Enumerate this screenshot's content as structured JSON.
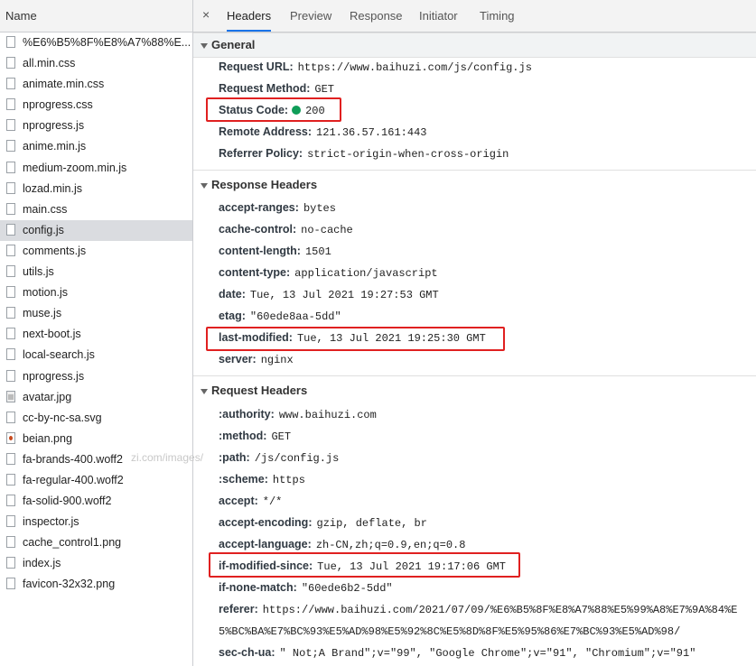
{
  "left_panel": {
    "header": "Name",
    "files": [
      {
        "name": "%E6%B5%8F%E8%A7%88%E...",
        "icon": "doc-icon"
      },
      {
        "name": "all.min.css",
        "icon": "doc-icon"
      },
      {
        "name": "animate.min.css",
        "icon": "doc-icon"
      },
      {
        "name": "nprogress.css",
        "icon": "doc-icon"
      },
      {
        "name": "nprogress.js",
        "icon": "doc-icon"
      },
      {
        "name": "anime.min.js",
        "icon": "doc-icon"
      },
      {
        "name": "medium-zoom.min.js",
        "icon": "doc-icon"
      },
      {
        "name": "lozad.min.js",
        "icon": "doc-icon"
      },
      {
        "name": "main.css",
        "icon": "doc-icon"
      },
      {
        "name": "config.js",
        "icon": "doc-icon",
        "selected": true
      },
      {
        "name": "comments.js",
        "icon": "doc-icon"
      },
      {
        "name": "utils.js",
        "icon": "doc-icon"
      },
      {
        "name": "motion.js",
        "icon": "doc-icon"
      },
      {
        "name": "muse.js",
        "icon": "doc-icon"
      },
      {
        "name": "next-boot.js",
        "icon": "doc-icon"
      },
      {
        "name": "local-search.js",
        "icon": "doc-icon"
      },
      {
        "name": "nprogress.js",
        "icon": "doc-icon"
      },
      {
        "name": "avatar.jpg",
        "icon": "image-icon"
      },
      {
        "name": "cc-by-nc-sa.svg",
        "icon": "doc-icon"
      },
      {
        "name": "beian.png",
        "icon": "beian-image-icon"
      },
      {
        "name": "fa-brands-400.woff2",
        "icon": "doc-icon"
      },
      {
        "name": "fa-regular-400.woff2",
        "icon": "doc-icon"
      },
      {
        "name": "fa-solid-900.woff2",
        "icon": "doc-icon"
      },
      {
        "name": "inspector.js",
        "icon": "doc-icon"
      },
      {
        "name": "cache_control1.png",
        "icon": "doc-icon"
      },
      {
        "name": "index.js",
        "icon": "doc-icon"
      },
      {
        "name": "favicon-32x32.png",
        "icon": "doc-icon"
      }
    ],
    "watermark": "zi.com/images/"
  },
  "tabs": {
    "close": "×",
    "items": [
      "Headers",
      "Preview",
      "Response",
      "Initiator",
      "Timing"
    ],
    "active": "Headers"
  },
  "general": {
    "title": "General",
    "rows": [
      {
        "k": "Request URL:",
        "v": "https://www.baihuzi.com/js/config.js"
      },
      {
        "k": "Request Method:",
        "v": "GET"
      },
      {
        "k": "Status Code:",
        "v": "200"
      },
      {
        "k": "Remote Address:",
        "v": "121.36.57.161:443"
      },
      {
        "k": "Referrer Policy:",
        "v": "strict-origin-when-cross-origin"
      }
    ]
  },
  "response_headers": {
    "title": "Response Headers",
    "rows": [
      {
        "k": "accept-ranges:",
        "v": "bytes"
      },
      {
        "k": "cache-control:",
        "v": "no-cache"
      },
      {
        "k": "content-length:",
        "v": "1501"
      },
      {
        "k": "content-type:",
        "v": "application/javascript"
      },
      {
        "k": "date:",
        "v": "Tue, 13 Jul 2021 19:27:53 GMT"
      },
      {
        "k": "etag:",
        "v": "\"60ede8aa-5dd\""
      },
      {
        "k": "last-modified:",
        "v": "Tue, 13 Jul 2021 19:25:30 GMT"
      },
      {
        "k": "server:",
        "v": "nginx"
      }
    ]
  },
  "request_headers": {
    "title": "Request Headers",
    "rows": [
      {
        "k": ":authority:",
        "v": "www.baihuzi.com"
      },
      {
        "k": ":method:",
        "v": "GET"
      },
      {
        "k": ":path:",
        "v": "/js/config.js"
      },
      {
        "k": ":scheme:",
        "v": "https"
      },
      {
        "k": "accept:",
        "v": "*/*"
      },
      {
        "k": "accept-encoding:",
        "v": "gzip, deflate, br"
      },
      {
        "k": "accept-language:",
        "v": "zh-CN,zh;q=0.9,en;q=0.8"
      },
      {
        "k": "if-modified-since:",
        "v": "Tue, 13 Jul 2021 19:17:06 GMT"
      },
      {
        "k": "if-none-match:",
        "v": "\"60ede6b2-5dd\""
      },
      {
        "k": "referer:",
        "v": "https://www.baihuzi.com/2021/07/09/%E6%B5%8F%E8%A7%88%E5%99%A8%E7%9A%84%E",
        "v2": "5%BC%BA%E7%BC%93%E5%AD%98%E5%92%8C%E5%8D%8F%E5%95%86%E7%BC%93%E5%AD%98/"
      },
      {
        "k": "sec-ch-ua:",
        "v": "\" Not;A Brand\";v=\"99\", \"Google Chrome\";v=\"91\", \"Chromium\";v=\"91\""
      }
    ]
  },
  "colors": {
    "highlight": "#e02020",
    "status_ok": "#0f9d58",
    "tab_accent": "#1a73e8"
  }
}
